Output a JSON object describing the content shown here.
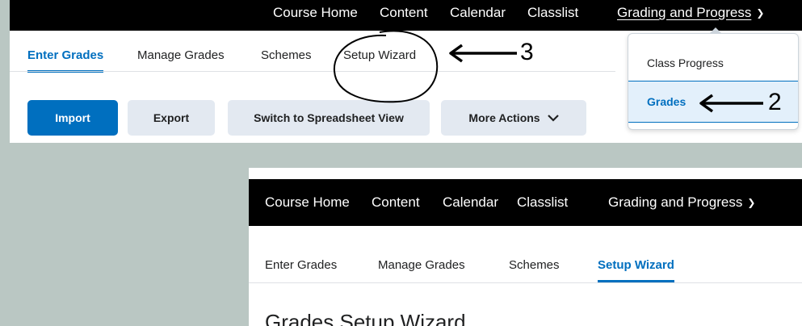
{
  "top_nav": {
    "items": [
      "Course Home",
      "Content",
      "Calendar",
      "Classlist",
      "Grading and Progress"
    ]
  },
  "top_tabs": [
    "Enter Grades",
    "Manage Grades",
    "Schemes",
    "Setup Wizard"
  ],
  "buttons": {
    "import": "Import",
    "export": "Export",
    "spreadsheet": "Switch to Spreadsheet View",
    "more_actions": "More Actions"
  },
  "dropdown": {
    "items": [
      "Class Progress",
      "Grades"
    ]
  },
  "annotations": {
    "step2": "2",
    "step3": "3"
  },
  "bottom_nav": {
    "items": [
      "Course Home",
      "Content",
      "Calendar",
      "Classlist",
      "Grading and Progress"
    ]
  },
  "bottom_tabs": [
    "Enter Grades",
    "Manage Grades",
    "Schemes",
    "Setup Wizard"
  ],
  "wizard_title": "Grades Setup Wizard",
  "colors": {
    "accent": "#006fbf",
    "background": "#bac7c3",
    "nav": "#000000"
  }
}
